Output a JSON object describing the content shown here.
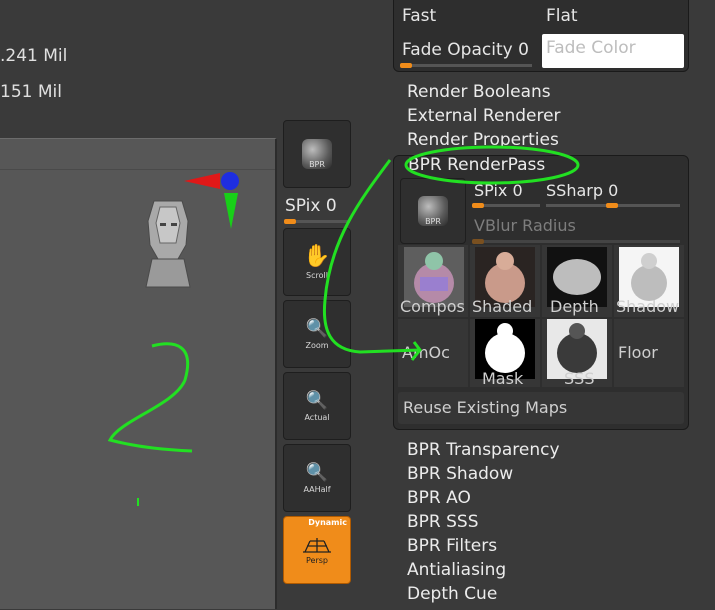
{
  "stats": {
    "line1": ".241 Mil",
    "line2": "151 Mil"
  },
  "top_panel": {
    "fast": "Fast",
    "flat": "Flat",
    "fade_opacity_label": "Fade Opacity",
    "fade_opacity_value": "0",
    "fade_color_placeholder": "Fade Color"
  },
  "render_menu": {
    "booleans": "Render Booleans",
    "external": "External Renderer",
    "properties": "Render Properties",
    "renderpass": "BPR RenderPass"
  },
  "renderpass": {
    "bpr_button": "BPR",
    "spix_label": "SPix",
    "spix_value": "0",
    "ssharp_label": "SSharp",
    "ssharp_value": "0",
    "vblur_label": "VBlur Radius",
    "thumbs": [
      "Compos",
      "Shaded",
      "Depth",
      "Shadow",
      "AmOc",
      "Mask",
      "SSS",
      "Floor"
    ],
    "reuse": "Reuse Existing Maps"
  },
  "side_tools": {
    "bpr": "BPR",
    "spix_label": "SPix",
    "spix_value": "0",
    "scroll": "Scroll",
    "zoom": "Zoom",
    "actual": "Actual",
    "aahalf": "AAHalf",
    "dynamic": "Dynamic",
    "persp": "Persp"
  },
  "bottom_menu": [
    "BPR Transparency",
    "BPR Shadow",
    "BPR AO",
    "BPR SSS",
    "BPR Filters",
    "Antialiasing",
    "Depth Cue"
  ],
  "colors": {
    "accent": "#f08c1a",
    "annotation": "#22e022"
  }
}
